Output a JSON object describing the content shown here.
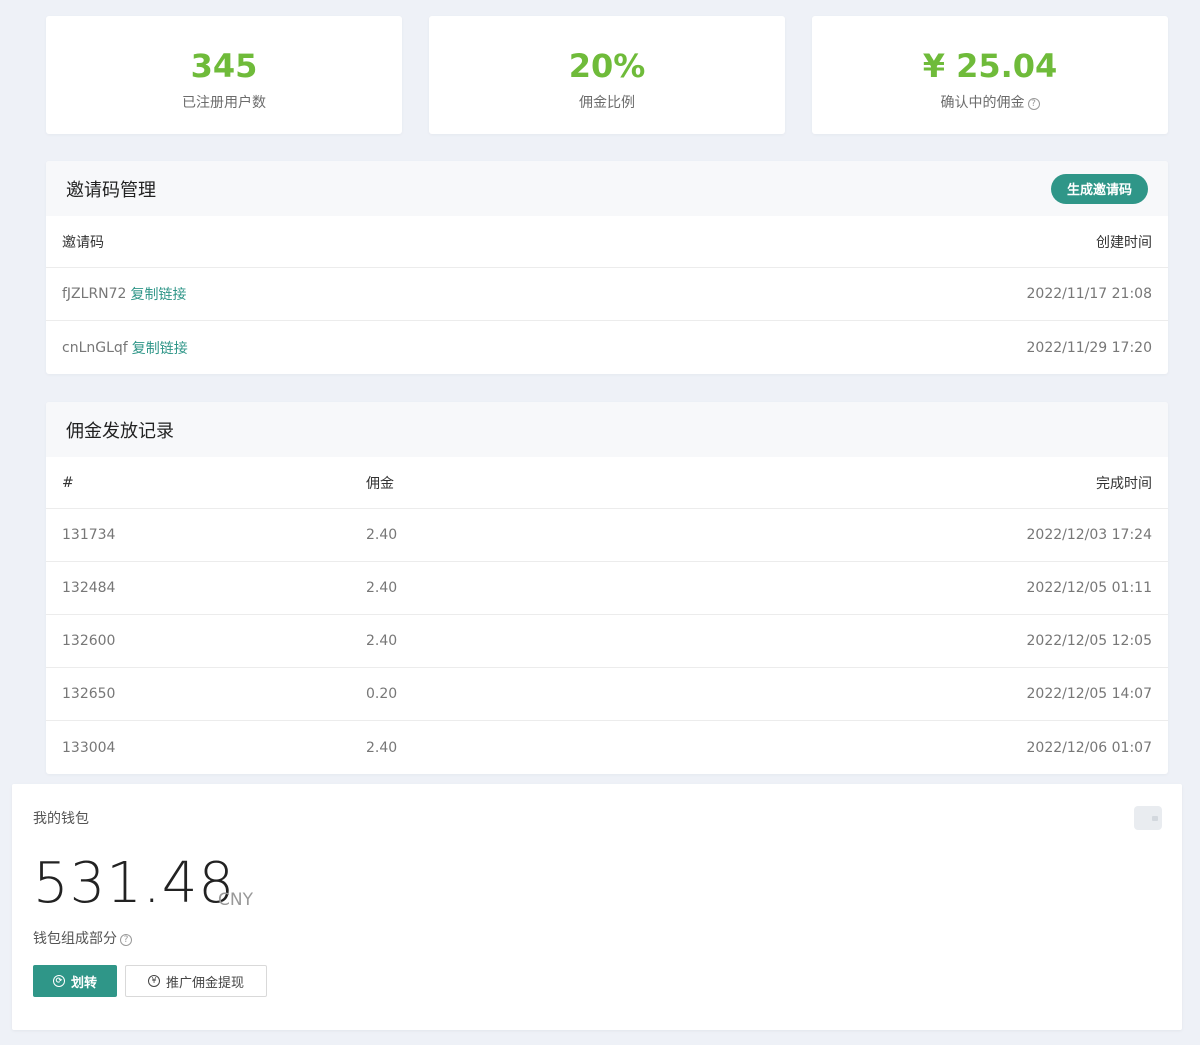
{
  "stats": [
    {
      "value": "345",
      "label": "已注册用户数"
    },
    {
      "value": "20%",
      "label": "佣金比例"
    },
    {
      "value": "¥ 25.04",
      "label": "确认中的佣金"
    }
  ],
  "invite": {
    "title": "邀请码管理",
    "generate_button": "生成邀请码",
    "columns": [
      "邀请码",
      "创建时间"
    ],
    "copy_label": "复制链接",
    "rows": [
      {
        "code": "fJZLRN72",
        "created": "2022/11/17 21:08"
      },
      {
        "code": "cnLnGLqf",
        "created": "2022/11/29 17:20"
      }
    ]
  },
  "commission": {
    "title": "佣金发放记录",
    "columns": [
      "#",
      "佣金",
      "完成时间"
    ],
    "rows": [
      {
        "id": "131734",
        "amount": "2.40",
        "time": "2022/12/03 17:24"
      },
      {
        "id": "132484",
        "amount": "2.40",
        "time": "2022/12/05 01:11"
      },
      {
        "id": "132600",
        "amount": "2.40",
        "time": "2022/12/05 12:05"
      },
      {
        "id": "132650",
        "amount": "0.20",
        "time": "2022/12/05 14:07"
      },
      {
        "id": "133004",
        "amount": "2.40",
        "time": "2022/12/06 01:07"
      }
    ]
  },
  "wallet": {
    "label": "我的钱包",
    "balance": "531.48",
    "currency": "CNY",
    "composition_label": "钱包组成部分",
    "transfer_button": "划转",
    "withdraw_button": "推广佣金提现"
  },
  "colors": {
    "accent": "#2f9688",
    "stat_value": "#6fbb3a",
    "background": "#eef1f7"
  },
  "icons": [
    "help-icon",
    "wallet-icon",
    "transfer-icon",
    "withdraw-icon"
  ]
}
